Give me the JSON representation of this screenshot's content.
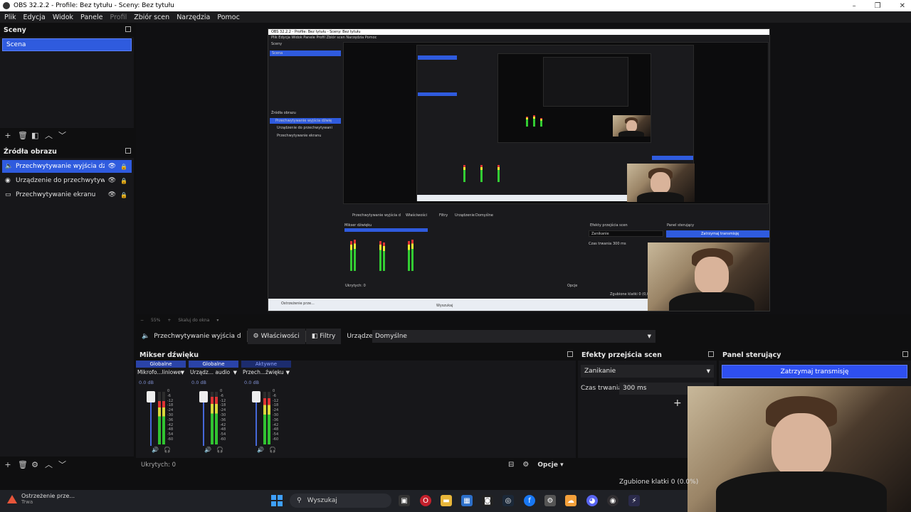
{
  "window": {
    "title": "OBS 32.2.2 - Profile: Bez tytułu - Sceny: Bez tytułu",
    "buttons": [
      "–",
      "❐",
      "✕"
    ]
  },
  "menu": [
    "Plik",
    "Edycja",
    "Widok",
    "Panele",
    "Profil",
    "Zbiór scen",
    "Narzędzia",
    "Pomoc"
  ],
  "scenes": {
    "title": "Sceny",
    "items": [
      "Scena"
    ]
  },
  "sources": {
    "title": "Źródła obrazu",
    "items": [
      {
        "label": "Przechwytywanie wyjścia dźwię",
        "icon": "speaker-icon"
      },
      {
        "label": "Urządzenie do przechwytywani",
        "icon": "camera-icon"
      },
      {
        "label": "Przechwytywanie ekranu",
        "icon": "monitor-icon"
      }
    ]
  },
  "preview": {
    "zoom": "55%",
    "scale_label": "Skaluj do okna",
    "mini": {
      "title": "OBS 32.2.2 - Profile: Bez tytułu - Sceny: Bez tytułu",
      "menu": "Plik   Edycja   Widok   Panele   Profil   Zbiór scen   Narzędzia   Pomoc",
      "scenes": "Sceny",
      "scene": "Scena",
      "sources": "Źródła obrazu",
      "src1": "Przechwytywanie wyjścia dźwię",
      "src2": "Urządzenie do przechwytywani",
      "src3": "Przechwytywanie ekranu",
      "ctx_src": "Przechwytywanie wyjścia d",
      "ctx_props": "Właściwości",
      "ctx_filters": "Filtry",
      "ctx_device": "Urządzenie",
      "ctx_default": "Domyślne",
      "mixer": "Mikser dźwięku",
      "transitions": "Efekty przejścia scen",
      "fade": "Zanikanie",
      "duration": "Czas trwania",
      "duration_val": "300 ms",
      "controls": "Panel sterujący",
      "stop": "Zatrzymaj transmisję",
      "hidden": "Ukrytych: 0",
      "options": "Opcje",
      "dropped": "Zgubione klatki 0 (0,0%)",
      "weather": "Ostrzeżenie prze...",
      "search": "Wyszukaj"
    }
  },
  "context": {
    "source": "Przechwytywanie wyjścia d",
    "properties": "Właściwości",
    "filters": "Filtry",
    "device_label": "Urządzenie",
    "device_value": "Domyślne"
  },
  "mixer": {
    "title": "Mikser dźwięku",
    "channels": [
      {
        "tag": "Globalne",
        "name": "Mikrofo...liniowe",
        "db": "0.0 dB",
        "level": 0.82,
        "active": false
      },
      {
        "tag": "Globalne",
        "name": "Urządz... audio",
        "db": "0.0 dB",
        "level": 0.9,
        "active": false
      },
      {
        "tag": "Aktywne",
        "name": "Przech...źwięku",
        "db": "0.0 dB",
        "level": 0.88,
        "active": true
      }
    ],
    "scale": [
      "0",
      "-6",
      "-12",
      "-18",
      "-24",
      "-30",
      "-36",
      "-42",
      "-48",
      "-54",
      "-60"
    ],
    "hidden": "Ukrytych: 0",
    "options": "Opcje"
  },
  "transitions": {
    "title": "Efekty przejścia scen",
    "selected": "Zanikanie",
    "duration_label": "Czas trwania",
    "duration_value": "300 ms"
  },
  "controls": {
    "title": "Panel sterujący",
    "stop_stream": "Zatrzymaj transmisję"
  },
  "status": {
    "dropped": "Zgubione klatki 0 (0.0%)"
  },
  "taskbar": {
    "weather_title": "Ostrzeżenie prze...",
    "weather_sub": "Trwa",
    "search": "Wyszukaj"
  },
  "colors": {
    "accent": "#2f5bde",
    "bg": "#0f0f10",
    "panel": "#17171a",
    "stop": "#2e4ff0"
  }
}
